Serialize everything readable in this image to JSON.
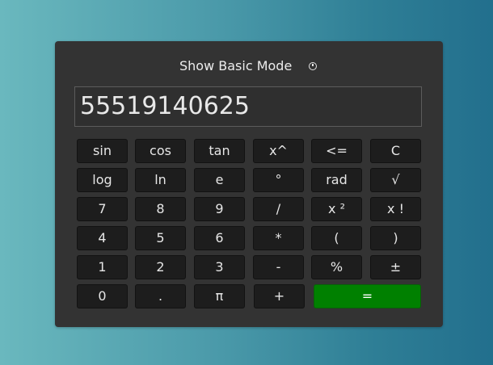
{
  "header": {
    "mode_label": "Show Basic Mode"
  },
  "display": {
    "value": "55519140625"
  },
  "buttons": {
    "sin": "sin",
    "cos": "cos",
    "tan": "tan",
    "power": "x^",
    "backspace": "<=",
    "clear": "C",
    "log": "log",
    "ln": "ln",
    "e": "e",
    "degree": "°",
    "rad": "rad",
    "sqrt": "√",
    "seven": "7",
    "eight": "8",
    "nine": "9",
    "divide": "/",
    "square": "x ²",
    "factorial": "x !",
    "four": "4",
    "five": "5",
    "six": "6",
    "multiply": "*",
    "open_paren": "(",
    "close_paren": ")",
    "one": "1",
    "two": "2",
    "three": "3",
    "minus": "-",
    "percent": "%",
    "plus_minus": "±",
    "zero": "0",
    "decimal": ".",
    "pi": "π",
    "plus": "+",
    "equals": "="
  },
  "colors": {
    "equals_button": "#008000",
    "panel": "#333333",
    "key": "#1d1d1d"
  }
}
